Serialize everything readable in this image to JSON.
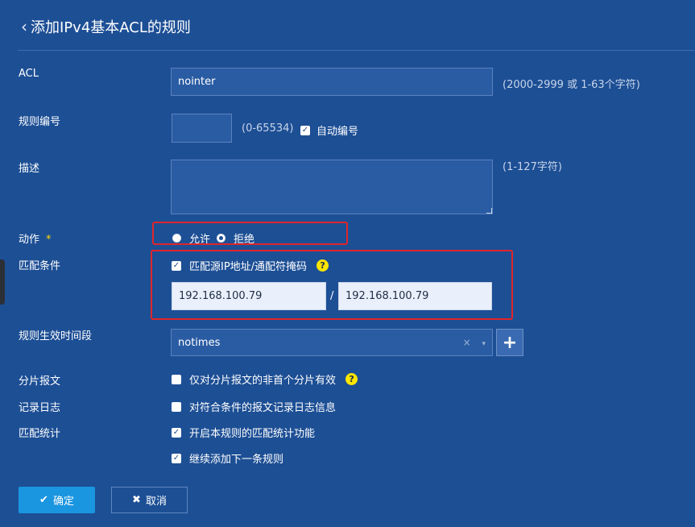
{
  "header": {
    "title": "添加IPv4基本ACL的规则"
  },
  "form": {
    "acl": {
      "label": "ACL",
      "value": "nointer",
      "hint": "(2000-2999 或 1-63个字符)"
    },
    "rule_no": {
      "label": "规则编号",
      "value": "",
      "hint": "(0-65534)",
      "auto_label": "自动编号",
      "auto_checked": true
    },
    "desc": {
      "label": "描述",
      "value": "",
      "hint": "(1-127字符)"
    },
    "action": {
      "label": "动作",
      "required_mark": "*",
      "options": [
        "允许",
        "拒绝"
      ],
      "selected": "拒绝"
    },
    "match": {
      "label": "匹配条件",
      "checkbox_label": "匹配源IP地址/通配符掩码",
      "checked": true,
      "ip": "192.168.100.79",
      "separator": "/",
      "wildcard": "192.168.100.79"
    },
    "time_range": {
      "label": "规则生效时间段",
      "value": "notimes",
      "clear": "×",
      "arrow": "▾",
      "add": "+"
    },
    "fragment": {
      "label": "分片报文",
      "checkbox_label": "仅对分片报文的非首个分片有效",
      "checked": false
    },
    "logging": {
      "label": "记录日志",
      "checkbox_label": "对符合条件的报文记录日志信息",
      "checked": false
    },
    "stats": {
      "label": "匹配统计",
      "checkbox_label": "开启本规则的匹配统计功能",
      "checked": true
    },
    "continue_add": {
      "checkbox_label": "继续添加下一条规则",
      "checked": true
    }
  },
  "buttons": {
    "ok": "确定",
    "cancel": "取消"
  },
  "help_icon": "?",
  "colors": {
    "background": "#1d4f95",
    "primary_button": "#1a95e0",
    "highlight_box": "#e0252a",
    "help_icon": "#ffe600"
  }
}
